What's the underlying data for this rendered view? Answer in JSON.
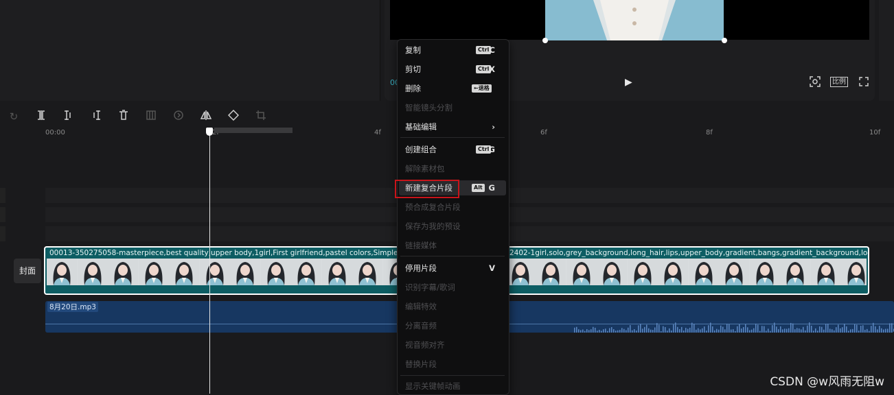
{
  "preview": {
    "time_fragment": "00",
    "ratio_label": "比例"
  },
  "ruler": {
    "ticks": [
      "00:00",
      "2f",
      "4f",
      "6f",
      "8f",
      "10f"
    ]
  },
  "tracks": {
    "cover_label": "封面",
    "video_clip_title": "00013-350275058-masterpiece,best quality,upper body,1girl,First girlfriend,pastel colors,Simple backgrou",
    "video_clip_title_tail": "2402-1girl,solo,grey_background,long_hair,lips,upper_body,gradient,bangs,gradient_background,looking_at_vie",
    "audio_clip_name": "8月20日.mp3"
  },
  "context_menu": {
    "items": [
      {
        "label": "复制",
        "mod": "Ctrl",
        "key": "C",
        "disabled": false
      },
      {
        "label": "剪切",
        "mod": "Ctrl",
        "key": "X",
        "disabled": false
      },
      {
        "label": "删除",
        "mod": "←退格",
        "key": "",
        "disabled": false
      },
      {
        "label": "智能镜头分割",
        "mod": "",
        "key": "",
        "disabled": true
      },
      {
        "label": "基础编辑",
        "mod": "",
        "key": "›",
        "disabled": false
      },
      {
        "label": "创建组合",
        "mod": "Ctrl",
        "key": "G",
        "disabled": false
      },
      {
        "label": "解除素材包",
        "mod": "",
        "key": "",
        "disabled": true
      },
      {
        "label": "新建复合片段",
        "mod": "Alt",
        "key": "G",
        "disabled": false
      },
      {
        "label": "预合成复合片段",
        "mod": "",
        "key": "",
        "disabled": true
      },
      {
        "label": "保存为我的预设",
        "mod": "",
        "key": "",
        "disabled": true
      },
      {
        "label": "链接媒体",
        "mod": "",
        "key": "",
        "disabled": true
      },
      {
        "label": "停用片段",
        "mod": "",
        "key": "V",
        "disabled": false
      },
      {
        "label": "识别字幕/歌词",
        "mod": "",
        "key": "",
        "disabled": true
      },
      {
        "label": "编辑特效",
        "mod": "",
        "key": "",
        "disabled": true
      },
      {
        "label": "分离音频",
        "mod": "",
        "key": "",
        "disabled": true
      },
      {
        "label": "视音频对齐",
        "mod": "",
        "key": "",
        "disabled": true
      },
      {
        "label": "替换片段",
        "mod": "",
        "key": "",
        "disabled": true
      },
      {
        "label": "显示关键帧动画",
        "mod": "",
        "key": "",
        "disabled": true
      }
    ]
  },
  "watermark": "CSDN @w风雨无阻w",
  "colors": {
    "video_clip": "#0d5d63",
    "audio_clip": "#173761",
    "highlight": "#c8141a"
  }
}
